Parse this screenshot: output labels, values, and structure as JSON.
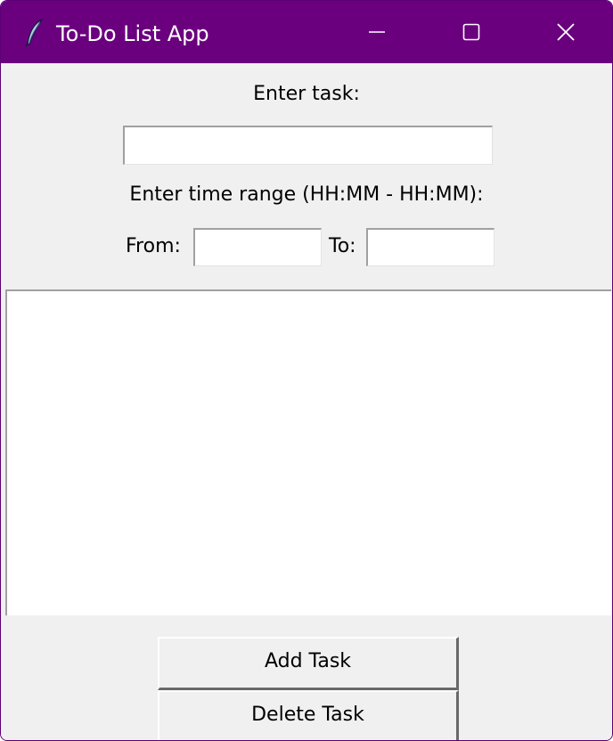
{
  "window": {
    "title": "To-Do List App",
    "accent_color": "#6b007f",
    "icons": {
      "app": "feather-icon",
      "minimize": "minimize-icon",
      "maximize": "maximize-icon",
      "close": "close-icon"
    }
  },
  "form": {
    "task_label": "Enter task:",
    "task_value": "",
    "range_label": "Enter time range (HH:MM - HH:MM):",
    "from_label": "From:",
    "from_value": "",
    "to_label": "To:",
    "to_value": ""
  },
  "task_list": {
    "items": []
  },
  "buttons": {
    "add_label": "Add Task",
    "delete_label": "Delete Task"
  }
}
